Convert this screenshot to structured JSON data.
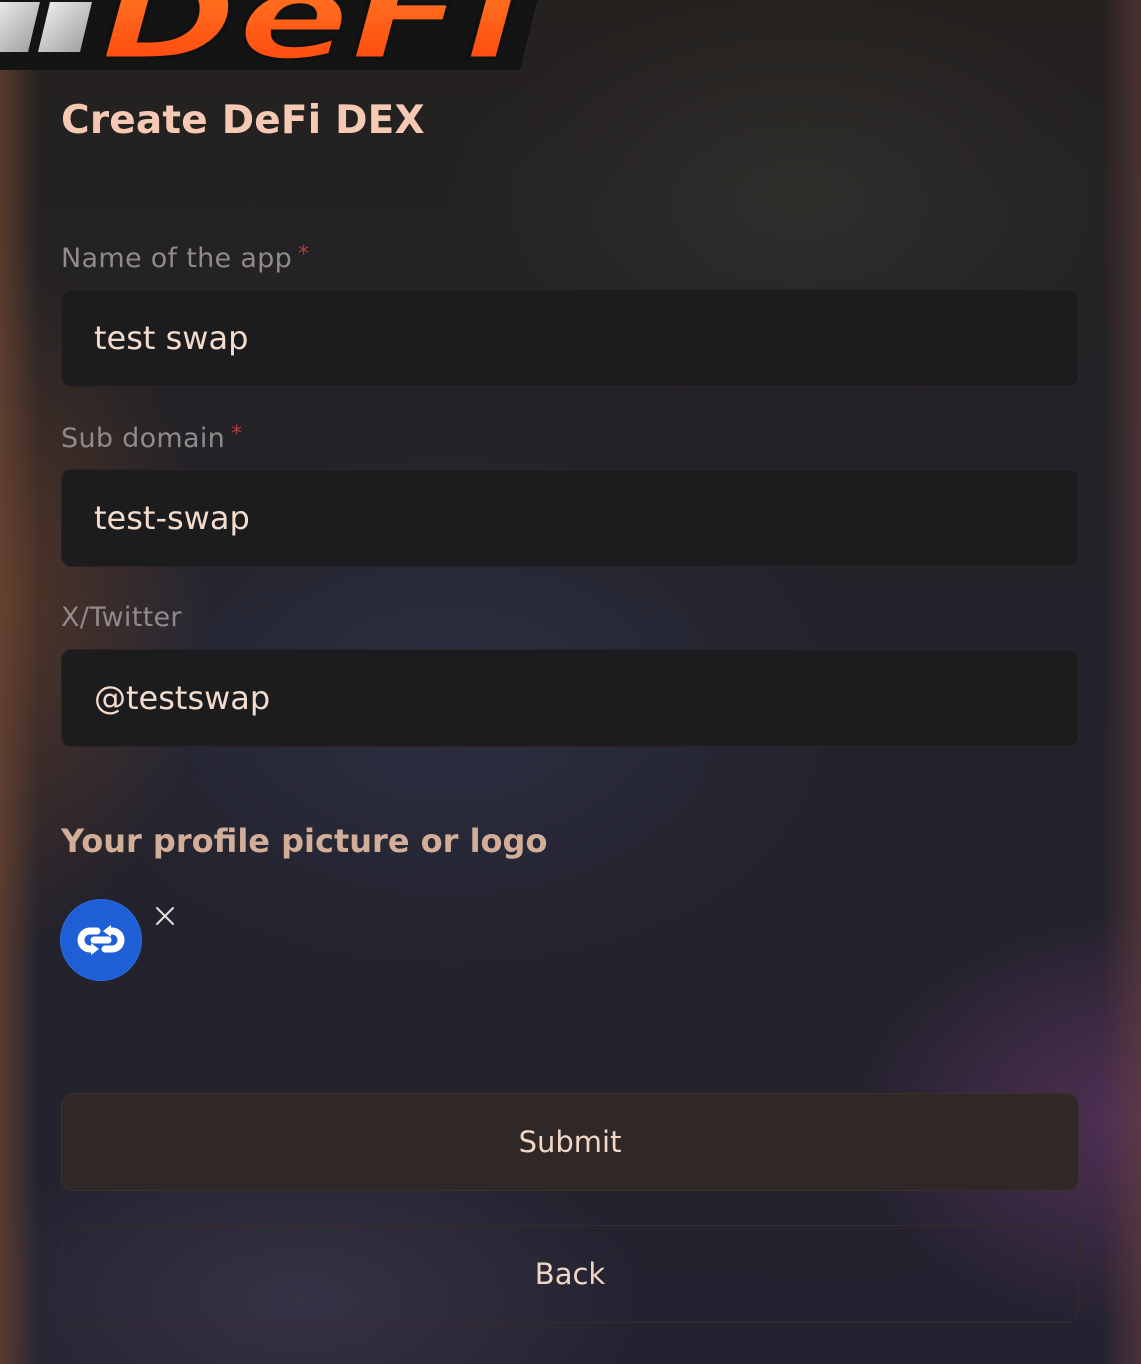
{
  "brand": {
    "logo_text": "DeFi"
  },
  "page": {
    "title": "Create DeFi DEX"
  },
  "form": {
    "app_name": {
      "label": "Name of the app",
      "required_mark": "*",
      "value": "test swap"
    },
    "sub_domain": {
      "label": "Sub domain",
      "required_mark": "*",
      "value": "test-swap"
    },
    "twitter": {
      "label": "X/Twitter",
      "value": "@testswap"
    }
  },
  "logo_section": {
    "heading": "Your profile picture or logo",
    "avatar_icon": "link-swap-icon",
    "remove_icon": "close-icon"
  },
  "actions": {
    "submit_label": "Submit",
    "back_label": "Back"
  },
  "colors": {
    "title": "#f5c9b3",
    "accent_orange": "#ff5a14",
    "required": "#b23a3a",
    "avatar_blue": "#1f5fd6"
  }
}
